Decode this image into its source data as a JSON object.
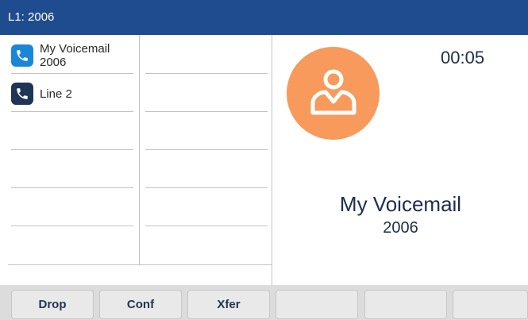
{
  "status_bar": {
    "line_label": "L1: 2006"
  },
  "line_keys": [
    {
      "name_line1": "My Voicemail",
      "name_line2": "2006",
      "state": "active",
      "icon": "phone-handset-icon"
    },
    {
      "name_line1": "Line 2",
      "name_line2": "",
      "state": "idle",
      "icon": "phone-handset-icon"
    }
  ],
  "call": {
    "timer": "00:05",
    "caller_name": "My Voicemail",
    "caller_number": "2006",
    "avatar_icon": "person-avatar-icon"
  },
  "softkeys": [
    {
      "label": "Drop"
    },
    {
      "label": "Conf"
    },
    {
      "label": "Xfer"
    },
    {
      "label": ""
    },
    {
      "label": ""
    },
    {
      "label": ""
    }
  ],
  "colors": {
    "status_bar": "#1f4c8f",
    "active_line_icon": "#1a86d8",
    "idle_line_icon": "#1f3555",
    "avatar": "#f89a5b",
    "text": "#1e2d4d"
  }
}
